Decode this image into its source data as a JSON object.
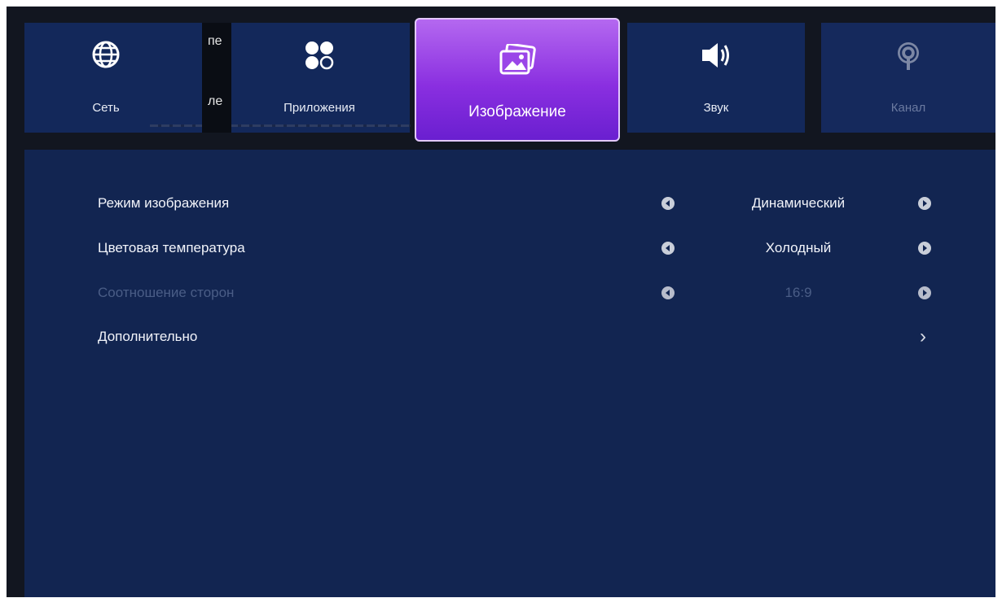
{
  "tabs": [
    {
      "label": "Сеть",
      "icon": "globe-icon"
    },
    {
      "label": "Приложения",
      "icon": "apps-icon"
    },
    {
      "label": "Изображение",
      "icon": "picture-icon",
      "selected": true
    },
    {
      "label": "Звук",
      "icon": "speaker-icon"
    },
    {
      "label": "Канал",
      "icon": "antenna-icon",
      "disabled": true
    }
  ],
  "overlay": {
    "fragment_top": "пе",
    "fragment_bottom": "ле"
  },
  "settings": [
    {
      "label": "Режим изображения",
      "value": "Динамический"
    },
    {
      "label": "Цветовая температура",
      "value": "Холодный"
    },
    {
      "label": "Соотношение сторон",
      "value": "16:9",
      "disabled": true
    },
    {
      "label": "Дополнительно"
    }
  ],
  "colors": {
    "background": "#121620",
    "panel": "#122551",
    "tab": "#13285a",
    "selected_tab_top": "#b468f0",
    "selected_tab_bottom": "#6a1fd0"
  }
}
